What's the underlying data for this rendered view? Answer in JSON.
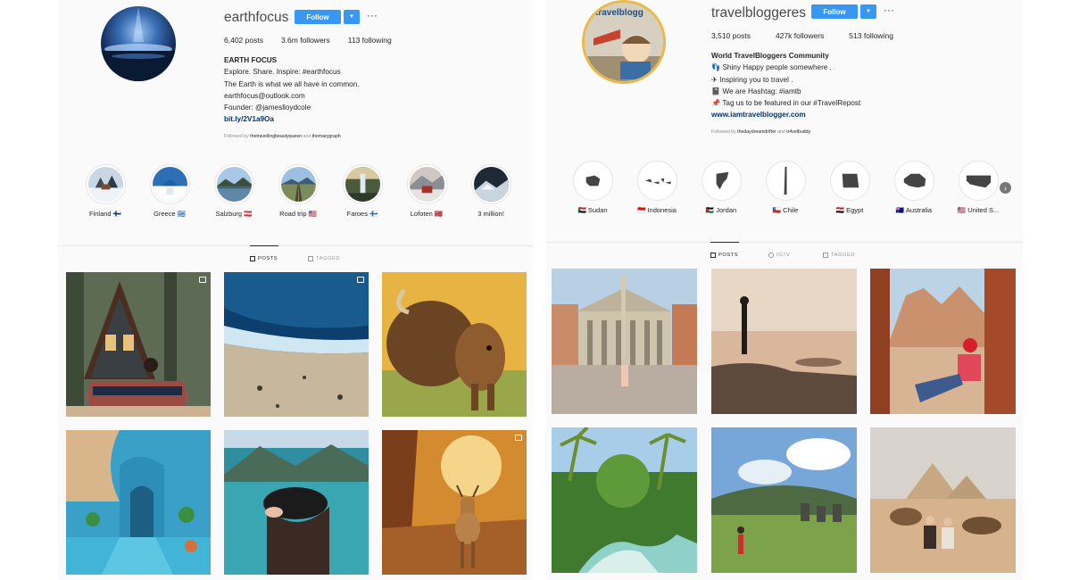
{
  "left_profile": {
    "username": "earthfocus",
    "follow_label": "Follow",
    "more_label": "···",
    "stats": {
      "posts": "6,402 posts",
      "followers": "3.6m followers",
      "following": "113 following"
    },
    "bio": {
      "name": "EARTH FOCUS",
      "line1": "Explore. Share. Inspire: #earthfocus",
      "line2": "The Earth is what we all have in common.",
      "line3": "earthfocus@outlook.com",
      "line4": "Founder: @jameslloydcole",
      "link": "bit.ly/2V1a9Oa"
    },
    "followed_by": {
      "prefix": "Followed by",
      "user1": "thetravellingbeautyqueen",
      "and": "and",
      "user2": "themarygraph"
    },
    "highlights": [
      {
        "label": "Finland 🇫🇮"
      },
      {
        "label": "Greece 🇬🇷"
      },
      {
        "label": "Salzburg 🇦🇹"
      },
      {
        "label": "Road trip 🇺🇸"
      },
      {
        "label": "Faroes 🇫🇴"
      },
      {
        "label": "Lofoten 🇳🇴"
      },
      {
        "label": "3 million!"
      }
    ],
    "tabs": {
      "posts": "POSTS",
      "tagged": "TAGGED"
    }
  },
  "right_profile": {
    "username": "travelbloggeres",
    "avatar_text": "travelblogg",
    "follow_label": "Follow",
    "more_label": "···",
    "stats": {
      "posts": "3,510 posts",
      "followers": "427k followers",
      "following": "513 following"
    },
    "bio": {
      "name": "World TravelBloggers Community",
      "line1": "👣 Shiny Happy people somewhere .",
      "line2": "✈ Inspiring you to travel .",
      "line3": "📓 We are Hashtag: #iamtb",
      "line4": "📌 Tag us to be featured in our #TravelRepost",
      "link": "www.iamtravelblogger.com"
    },
    "followed_by": {
      "prefix": "Followed by",
      "user1": "thedaydreamdrifter",
      "and": "and",
      "user2": "tr4velbuddy"
    },
    "highlights": [
      {
        "label": "🇸🇩 Sudan"
      },
      {
        "label": "🇮🇩 Indonesia"
      },
      {
        "label": "🇯🇴 Jordan"
      },
      {
        "label": "🇨🇱 Chile"
      },
      {
        "label": "🇪🇬 Egypt"
      },
      {
        "label": "🇦🇺 Australia"
      },
      {
        "label": "🇺🇸 United S..."
      }
    ],
    "tabs": {
      "posts": "POSTS",
      "igtv": "IGTV",
      "tagged": "TAGGED"
    }
  },
  "colors": {
    "follow_blue": "#3897f0",
    "link_blue": "#00376b",
    "muted_gray": "#8e8e8e"
  }
}
